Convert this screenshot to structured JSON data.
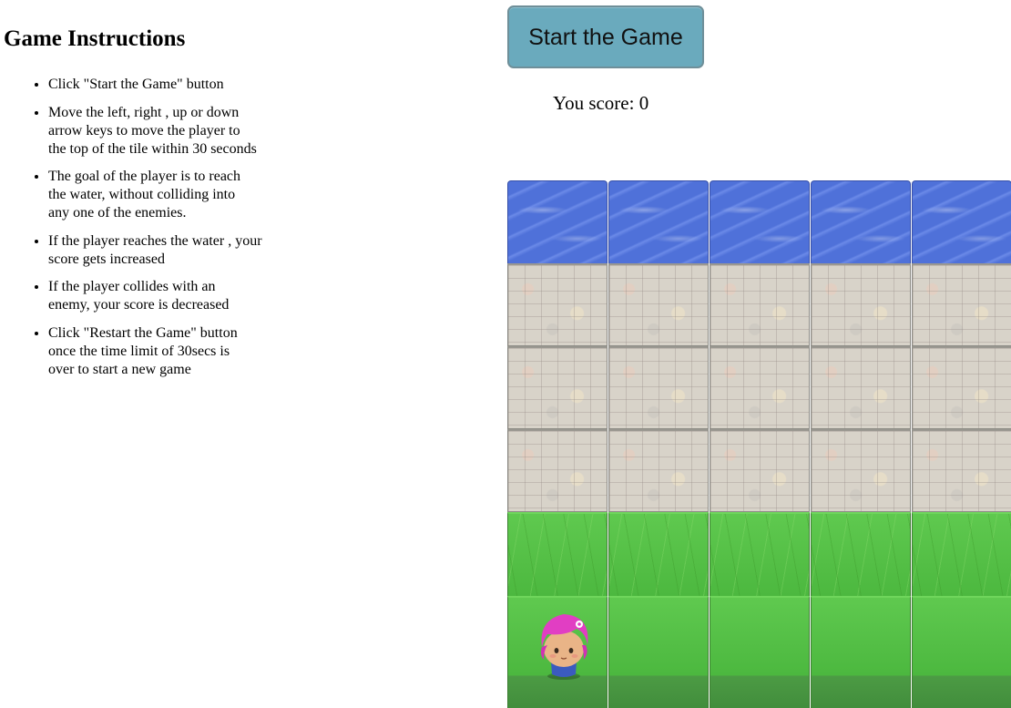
{
  "instructions": {
    "title": "Game Instructions",
    "items": [
      "Click \"Start the Game\" button",
      "Move the left, right , up or down arrow keys to move the player to the top of the tile within 30 seconds",
      "The goal of the player is to reach the water, without colliding into any one of the enemies.",
      "If the player reaches the water , your score gets increased",
      "If the player collides with an enemy, your score is decreased",
      "Click \"Restart the Game\" button once the time limit of 30secs is over to start a new game"
    ]
  },
  "controls": {
    "start_label": "Start the Game",
    "button_color": "#6aaabd"
  },
  "score": {
    "label": "You score: 0"
  },
  "board": {
    "columns_visible": 5,
    "rows": [
      "water",
      "stone",
      "stone",
      "stone",
      "grass",
      "grass"
    ],
    "player": {
      "icon": "pink-hair-girl-character-icon",
      "row": 6,
      "column": 1
    }
  }
}
